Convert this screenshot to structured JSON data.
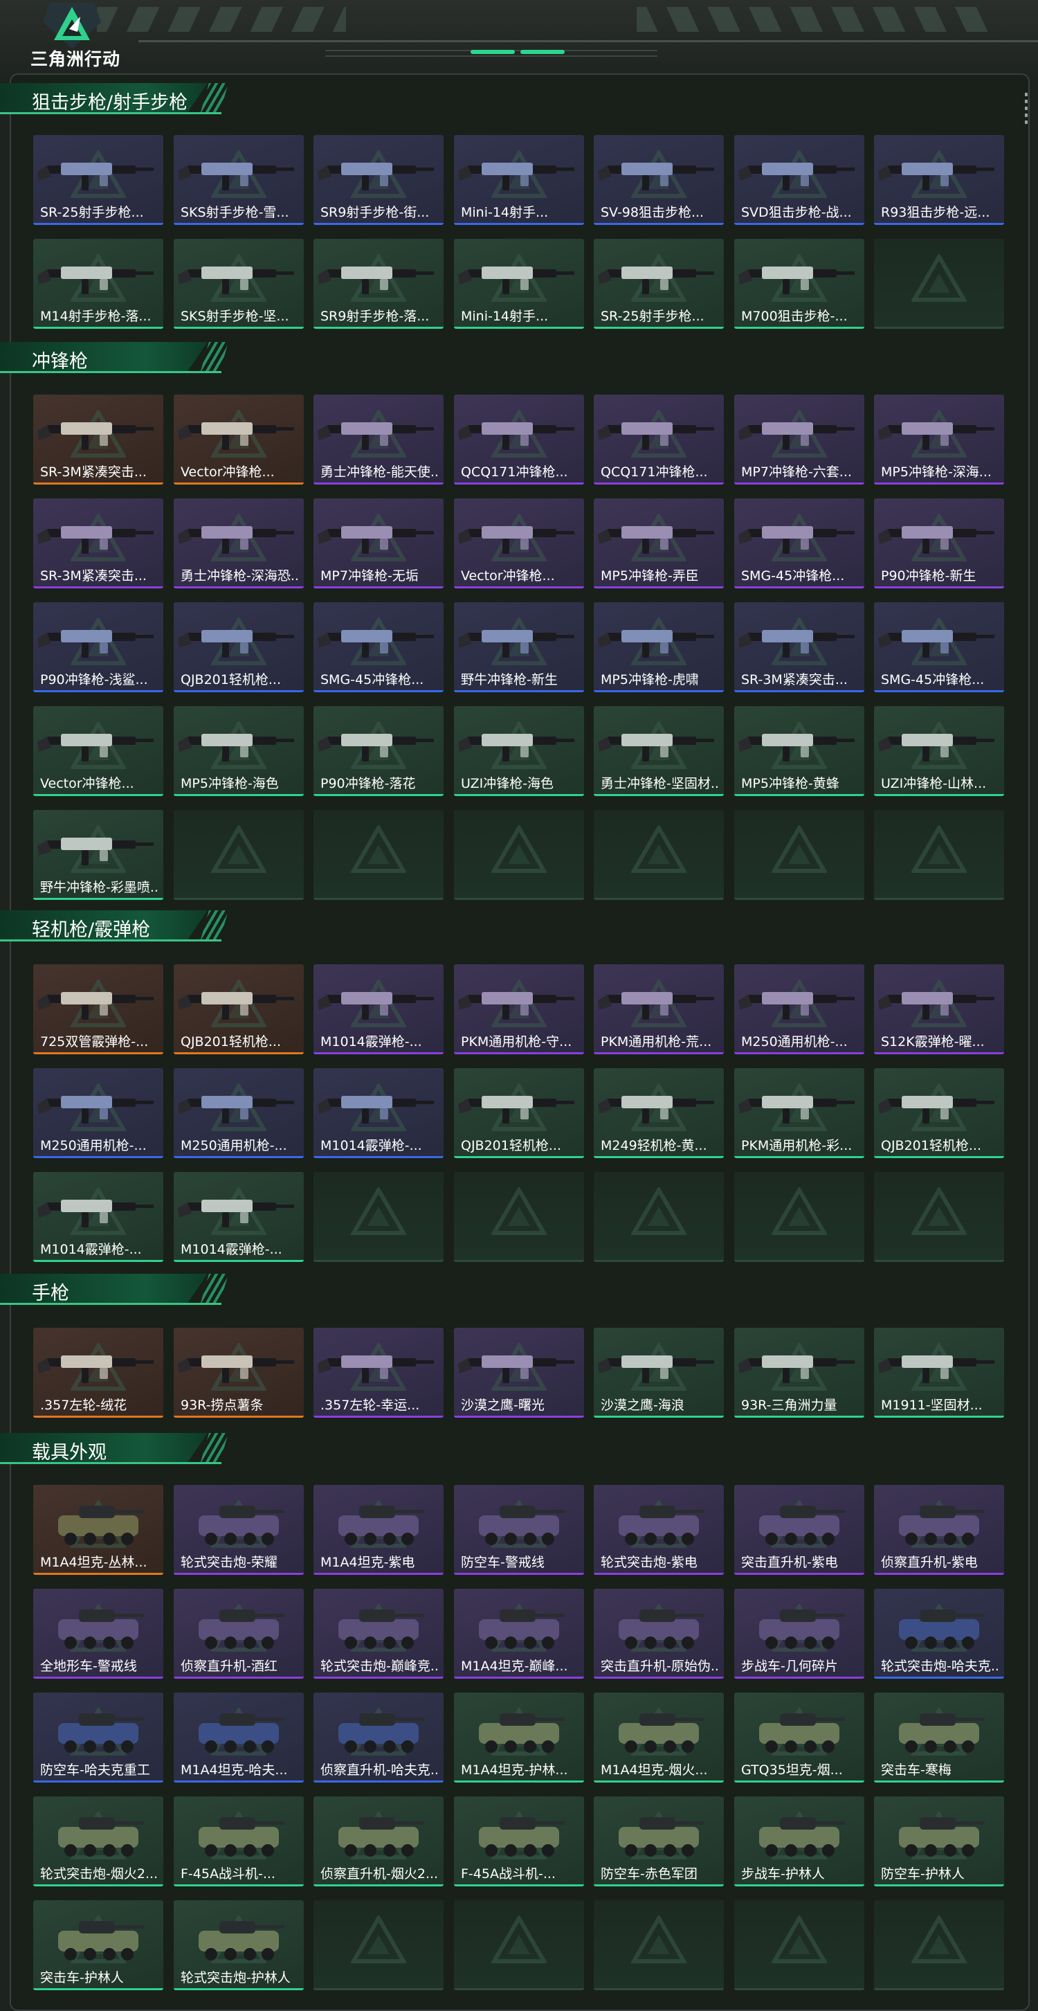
{
  "header": {
    "logo_text": "三角洲行动"
  },
  "colors": {
    "accent": "#2fd28c",
    "purple": "#8a3fe0",
    "blue": "#3a68ea",
    "orange": "#e2771f",
    "gray": "#8e9692"
  },
  "sections": [
    {
      "title": "狙击步枪/射手步枪",
      "kind": "gun",
      "items": [
        {
          "label": "SR-25射手步枪...",
          "rarity": "blue"
        },
        {
          "label": "SKS射手步枪-雪...",
          "rarity": "blue"
        },
        {
          "label": "SR9射手步枪-街...",
          "rarity": "blue"
        },
        {
          "label": "Mini-14射手...",
          "rarity": "blue"
        },
        {
          "label": "SV-98狙击步枪...",
          "rarity": "blue"
        },
        {
          "label": "SVD狙击步枪-战...",
          "rarity": "blue"
        },
        {
          "label": "R93狙击步枪-远...",
          "rarity": "blue"
        },
        {
          "label": "M14射手步枪-落...",
          "rarity": "green"
        },
        {
          "label": "SKS射手步枪-坚...",
          "rarity": "green"
        },
        {
          "label": "SR9射手步枪-落...",
          "rarity": "green"
        },
        {
          "label": "Mini-14射手...",
          "rarity": "green"
        },
        {
          "label": "SR-25射手步枪...",
          "rarity": "green"
        },
        {
          "label": "M700狙击步枪-...",
          "rarity": "green"
        },
        {
          "label": "",
          "rarity": "gray"
        }
      ]
    },
    {
      "title": "冲锋枪",
      "kind": "gun",
      "items": [
        {
          "label": "SR-3M紧凑突击...",
          "rarity": "orange"
        },
        {
          "label": "Vector冲锋枪...",
          "rarity": "orange"
        },
        {
          "label": "勇士冲锋枪-能天使...",
          "rarity": "purple"
        },
        {
          "label": "QCQ171冲锋枪...",
          "rarity": "purple"
        },
        {
          "label": "QCQ171冲锋枪...",
          "rarity": "purple"
        },
        {
          "label": "MP7冲锋枪-六套...",
          "rarity": "purple"
        },
        {
          "label": "MP5冲锋枪-深海...",
          "rarity": "purple"
        },
        {
          "label": "SR-3M紧凑突击...",
          "rarity": "purple"
        },
        {
          "label": "勇士冲锋枪-深海恐...",
          "rarity": "purple"
        },
        {
          "label": "MP7冲锋枪-无垢",
          "rarity": "purple"
        },
        {
          "label": "Vector冲锋枪...",
          "rarity": "purple"
        },
        {
          "label": "MP5冲锋枪-弄臣",
          "rarity": "purple"
        },
        {
          "label": "SMG-45冲锋枪...",
          "rarity": "purple"
        },
        {
          "label": "P90冲锋枪-新生",
          "rarity": "purple"
        },
        {
          "label": "P90冲锋枪-浅鲨...",
          "rarity": "blue"
        },
        {
          "label": "QJB201轻机枪...",
          "rarity": "blue"
        },
        {
          "label": "SMG-45冲锋枪...",
          "rarity": "blue"
        },
        {
          "label": "野牛冲锋枪-新生",
          "rarity": "blue"
        },
        {
          "label": "MP5冲锋枪-虎啸",
          "rarity": "blue"
        },
        {
          "label": "SR-3M紧凑突击...",
          "rarity": "blue"
        },
        {
          "label": "SMG-45冲锋枪...",
          "rarity": "blue"
        },
        {
          "label": "Vector冲锋枪...",
          "rarity": "green"
        },
        {
          "label": "MP5冲锋枪-海色",
          "rarity": "green"
        },
        {
          "label": "P90冲锋枪-落花",
          "rarity": "green"
        },
        {
          "label": "UZI冲锋枪-海色",
          "rarity": "green"
        },
        {
          "label": "勇士冲锋枪-坚固材...",
          "rarity": "green"
        },
        {
          "label": "MP5冲锋枪-黄蜂",
          "rarity": "green"
        },
        {
          "label": "UZI冲锋枪-山林...",
          "rarity": "green"
        },
        {
          "label": "野牛冲锋枪-彩墨喷...",
          "rarity": "green"
        },
        {
          "label": "",
          "rarity": "empty"
        },
        {
          "label": "",
          "rarity": "empty"
        },
        {
          "label": "",
          "rarity": "empty"
        },
        {
          "label": "",
          "rarity": "empty"
        },
        {
          "label": "",
          "rarity": "empty"
        },
        {
          "label": "",
          "rarity": "empty"
        }
      ]
    },
    {
      "title": "轻机枪/霰弹枪",
      "kind": "gun",
      "items": [
        {
          "label": "725双管霰弹枪-...",
          "rarity": "orange"
        },
        {
          "label": "QJB201轻机枪...",
          "rarity": "orange"
        },
        {
          "label": "M1014霰弹枪-...",
          "rarity": "purple"
        },
        {
          "label": "PKM通用机枪-守...",
          "rarity": "purple"
        },
        {
          "label": "PKM通用机枪-荒...",
          "rarity": "purple"
        },
        {
          "label": "M250通用机枪-...",
          "rarity": "purple"
        },
        {
          "label": "S12K霰弹枪-曜...",
          "rarity": "purple"
        },
        {
          "label": "M250通用机枪-...",
          "rarity": "blue"
        },
        {
          "label": "M250通用机枪-...",
          "rarity": "blue"
        },
        {
          "label": "M1014霰弹枪-...",
          "rarity": "blue"
        },
        {
          "label": "QJB201轻机枪...",
          "rarity": "green"
        },
        {
          "label": "M249轻机枪-黄...",
          "rarity": "green"
        },
        {
          "label": "PKM通用机枪-彩...",
          "rarity": "green"
        },
        {
          "label": "QJB201轻机枪...",
          "rarity": "green"
        },
        {
          "label": "M1014霰弹枪-...",
          "rarity": "green"
        },
        {
          "label": "M1014霰弹枪-...",
          "rarity": "green"
        },
        {
          "label": "",
          "rarity": "gray"
        },
        {
          "label": "",
          "rarity": "gray"
        },
        {
          "label": "",
          "rarity": "gray"
        },
        {
          "label": "",
          "rarity": "gray"
        },
        {
          "label": "",
          "rarity": "gray"
        }
      ]
    },
    {
      "title": "手枪",
      "kind": "gun",
      "items": [
        {
          "label": ".357左轮-绒花",
          "rarity": "orange"
        },
        {
          "label": "93R-捞点薯条",
          "rarity": "orange"
        },
        {
          "label": ".357左轮-幸运...",
          "rarity": "purple"
        },
        {
          "label": "沙漠之鹰-曙光",
          "rarity": "purple"
        },
        {
          "label": "沙漠之鹰-海浪",
          "rarity": "green"
        },
        {
          "label": "93R-三角洲力量",
          "rarity": "green"
        },
        {
          "label": "M1911-坚固材...",
          "rarity": "green"
        }
      ]
    },
    {
      "title": "载具外观",
      "kind": "vehicle",
      "items": [
        {
          "label": "M1A4坦克-丛林...",
          "rarity": "orange"
        },
        {
          "label": "轮式突击炮-荣耀",
          "rarity": "purple"
        },
        {
          "label": "M1A4坦克-紫电",
          "rarity": "purple"
        },
        {
          "label": "防空车-警戒线",
          "rarity": "purple"
        },
        {
          "label": "轮式突击炮-紫电",
          "rarity": "purple"
        },
        {
          "label": "突击直升机-紫电",
          "rarity": "purple"
        },
        {
          "label": "侦察直升机-紫电",
          "rarity": "purple"
        },
        {
          "label": "全地形车-警戒线",
          "rarity": "purple"
        },
        {
          "label": "侦察直升机-酒红",
          "rarity": "purple"
        },
        {
          "label": "轮式突击炮-巅峰竞...",
          "rarity": "purple"
        },
        {
          "label": "M1A4坦克-巅峰...",
          "rarity": "purple"
        },
        {
          "label": "突击直升机-原始伪...",
          "rarity": "purple"
        },
        {
          "label": "步战车-几何碎片",
          "rarity": "purple"
        },
        {
          "label": "轮式突击炮-哈夫克...",
          "rarity": "blue"
        },
        {
          "label": "防空车-哈夫克重工",
          "rarity": "blue"
        },
        {
          "label": "M1A4坦克-哈夫...",
          "rarity": "blue"
        },
        {
          "label": "侦察直升机-哈夫克...",
          "rarity": "blue"
        },
        {
          "label": "M1A4坦克-护林...",
          "rarity": "green"
        },
        {
          "label": "M1A4坦克-烟火...",
          "rarity": "green"
        },
        {
          "label": "GTQ35坦克-烟...",
          "rarity": "green"
        },
        {
          "label": "突击车-寒梅",
          "rarity": "green"
        },
        {
          "label": "轮式突击炮-烟火2...",
          "rarity": "green"
        },
        {
          "label": "F-45A战斗机-...",
          "rarity": "green"
        },
        {
          "label": "侦察直升机-烟火2...",
          "rarity": "green"
        },
        {
          "label": "F-45A战斗机-...",
          "rarity": "green"
        },
        {
          "label": "防空车-赤色军团",
          "rarity": "green"
        },
        {
          "label": "步战车-护林人",
          "rarity": "green"
        },
        {
          "label": "防空车-护林人",
          "rarity": "green"
        },
        {
          "label": "突击车-护林人",
          "rarity": "green"
        },
        {
          "label": "轮式突击炮-护林人",
          "rarity": "green"
        },
        {
          "label": "",
          "rarity": "green"
        },
        {
          "label": "",
          "rarity": "green"
        },
        {
          "label": "",
          "rarity": "green"
        },
        {
          "label": "",
          "rarity": "green"
        },
        {
          "label": "",
          "rarity": "green"
        }
      ]
    }
  ]
}
